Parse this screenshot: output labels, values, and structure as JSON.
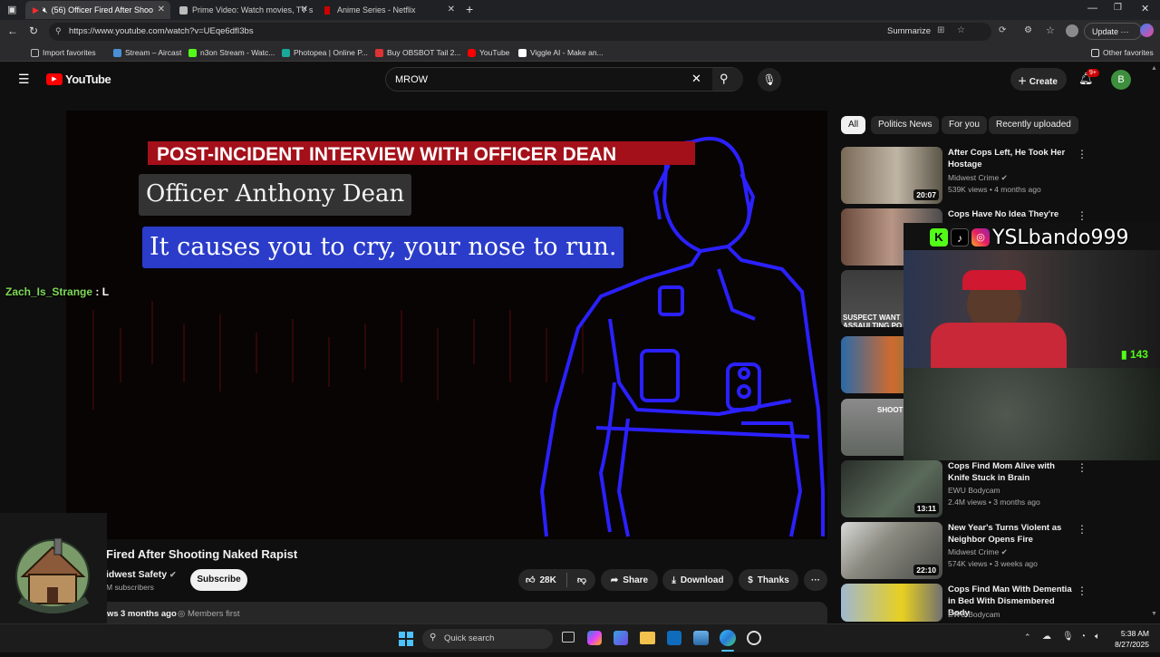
{
  "browser": {
    "tabs": [
      {
        "label": "(56) Officer Fired After Shoo",
        "active": true
      },
      {
        "label": "Prime Video: Watch movies, TV s"
      },
      {
        "label": "Anime Series - Netflix"
      }
    ],
    "url": "https://www.youtube.com/watch?v=UEqe6dfI3bs",
    "summarize_label": "Summarize",
    "update_label": "Update",
    "profile_initial": "B",
    "favorites": [
      {
        "label": "Import favorites"
      },
      {
        "label": "Stream – Aircast"
      },
      {
        "label": "n3on Stream - Watc..."
      },
      {
        "label": "Photopea | Online P..."
      },
      {
        "label": "Buy OBSBOT Tail 2..."
      },
      {
        "label": "YouTube"
      },
      {
        "label": "Viggle AI - Make an..."
      }
    ],
    "other_favorites": "Other favorites"
  },
  "youtube": {
    "logo_text": "YouTube",
    "search_value": "MROW",
    "create_label": "Create",
    "notif_badge": "9+",
    "avatar_initial": "B",
    "chips": [
      "All",
      "Politics News",
      "For you",
      "Recently uploaded"
    ]
  },
  "video": {
    "banner": "POST-INCIDENT INTERVIEW WITH OFFICER DEAN",
    "name_caption": "Officer Anthony Dean",
    "subtitle": "It causes you to cry, your nose to run.",
    "title": "Fired After Shooting Naked Rapist",
    "channel": "idwest Safety",
    "subs": "M subscribers",
    "subscribe_label": "Subscribe",
    "likes": "28K",
    "share_label": "Share",
    "download_label": "Download",
    "thanks_label": "Thanks",
    "views_fragment": "ws",
    "age": "3 months ago",
    "members_first": "Members first"
  },
  "related": [
    {
      "title": "After Cops Left, He Took Her Hostage",
      "channel": "Midwest Crime",
      "meta": "539K views • 4 months ago",
      "duration": "20:07"
    },
    {
      "title": "Cops Have No Idea They're",
      "channel": "",
      "meta": "",
      "duration": ""
    },
    {
      "title": "",
      "channel": "",
      "meta": "",
      "duration": "",
      "thumb_text": "SUSPECT WANT ASSAULTING PO"
    },
    {
      "title": "",
      "channel": "",
      "meta": "",
      "duration": ""
    },
    {
      "title": "",
      "channel": "",
      "meta": "",
      "duration": "",
      "thumb_text": "SHOOT"
    },
    {
      "title": "Cops Find Mom Alive with Knife Stuck in Brain",
      "channel": "EWU Bodycam",
      "meta": "2.4M views • 3 months ago",
      "duration": "13:11"
    },
    {
      "title": "New Year's Turns Violent as Neighbor Opens Fire",
      "channel": "Midwest Crime",
      "meta": "574K views • 3 weeks ago",
      "duration": "22:10"
    },
    {
      "title": "Cops Find Man With Dementia in Bed With Dismembered Body",
      "channel": "EWU Bodycam",
      "meta": "",
      "duration": ""
    }
  ],
  "overlays": {
    "streamer_handle": "YSLbando999",
    "chat_user": "Zach_Is_Strange",
    "chat_message": " : L",
    "kick_count": "143"
  },
  "taskbar": {
    "search_placeholder": "Quick search",
    "time": "5:38 AM",
    "date": "8/27/2025"
  }
}
